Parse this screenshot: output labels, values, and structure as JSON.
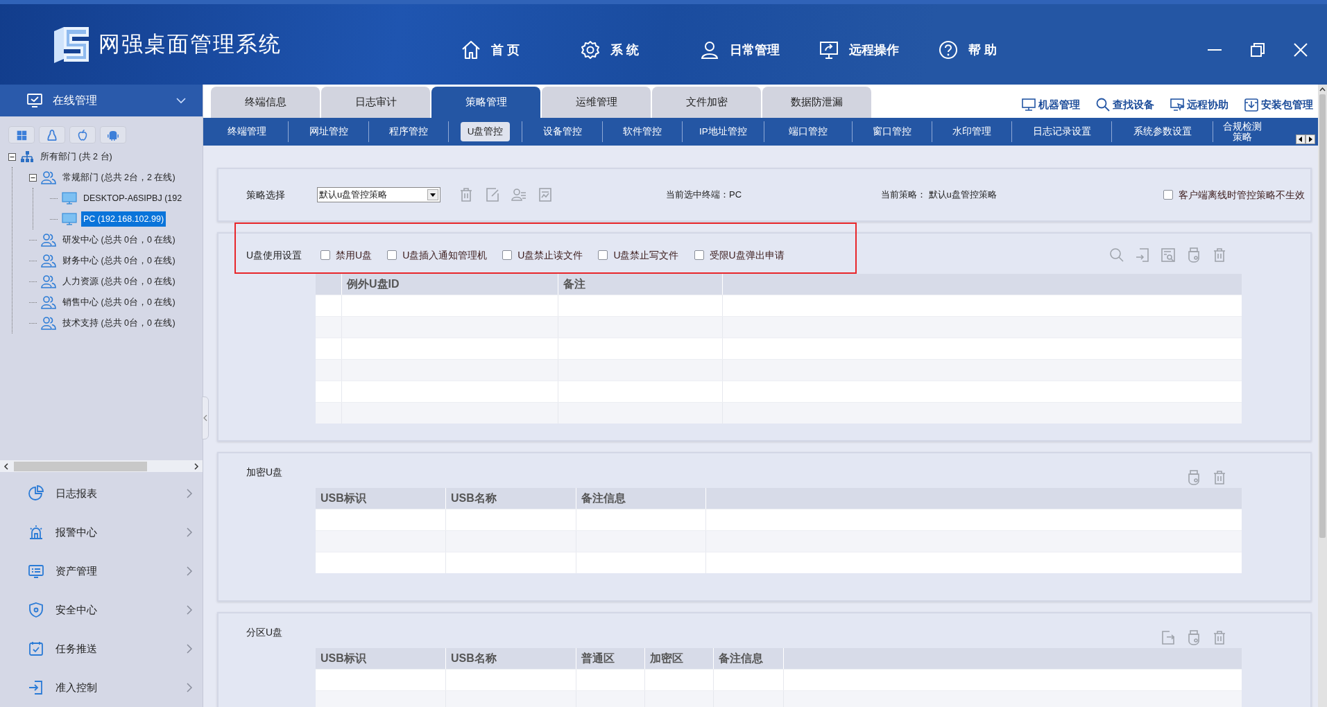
{
  "header": {
    "title": "网强桌面管理系统",
    "nav": [
      {
        "label": "首 页",
        "kind": "home"
      },
      {
        "label": "系 统",
        "kind": "settings"
      },
      {
        "label": "日常管理",
        "kind": "user"
      },
      {
        "label": "远程操作",
        "kind": "remote"
      },
      {
        "label": "帮 助",
        "kind": "help"
      }
    ]
  },
  "sidebar": {
    "section": {
      "label": "在线管理",
      "expanded": true
    },
    "tree": [
      {
        "label": "所有部门 (共 2 台)",
        "kind": "root",
        "expanded": true,
        "children": [
          {
            "label": "常规部门 (总共 2台，2 在线)",
            "kind": "group",
            "expanded": true,
            "children": [
              {
                "label": "DESKTOP-A6SIPBJ (192",
                "kind": "device",
                "selected": false
              },
              {
                "label": "PC (192.168.102.99)",
                "kind": "device",
                "selected": true
              }
            ]
          },
          {
            "label": "研发中心 (总共 0台，0 在线)",
            "kind": "group"
          },
          {
            "label": "财务中心 (总共 0台，0 在线)",
            "kind": "group"
          },
          {
            "label": "人力资源 (总共 0台，0 在线)",
            "kind": "group"
          },
          {
            "label": "销售中心 (总共 0台，0 在线)",
            "kind": "group"
          },
          {
            "label": "技术支持 (总共 0台，0 在线)",
            "kind": "group"
          }
        ]
      }
    ],
    "menu": [
      {
        "label": "日志报表",
        "kind": "report"
      },
      {
        "label": "报警中心",
        "kind": "alarm"
      },
      {
        "label": "资产管理",
        "kind": "asset"
      },
      {
        "label": "安全中心",
        "kind": "shield"
      },
      {
        "label": "任务推送",
        "kind": "task"
      },
      {
        "label": "准入控制",
        "kind": "access"
      }
    ]
  },
  "tabs": [
    {
      "label": "终端信息",
      "selected": false
    },
    {
      "label": "日志审计",
      "selected": false
    },
    {
      "label": "策略管理",
      "selected": true
    },
    {
      "label": "运维管理",
      "selected": false
    },
    {
      "label": "文件加密",
      "selected": false
    },
    {
      "label": "数据防泄漏",
      "selected": false
    }
  ],
  "tool_links": [
    {
      "label": "机器管理",
      "kind": "monitor"
    },
    {
      "label": "查找设备",
      "kind": "search"
    },
    {
      "label": "远程协助",
      "kind": "remote"
    },
    {
      "label": "安装包管理",
      "kind": "package"
    }
  ],
  "subtabs": [
    {
      "label": "终端管理",
      "selected": false
    },
    {
      "label": "网址管控",
      "selected": false
    },
    {
      "label": "程序管控",
      "selected": false
    },
    {
      "label": "U盘管控",
      "selected": true
    },
    {
      "label": "设备管控",
      "selected": false
    },
    {
      "label": "软件管控",
      "selected": false
    },
    {
      "label": "IP地址管控",
      "selected": false
    },
    {
      "label": "端口管控",
      "selected": false
    },
    {
      "label": "窗口管控",
      "selected": false
    },
    {
      "label": "水印管理",
      "selected": false
    },
    {
      "label": "日志记录设置",
      "selected": false
    },
    {
      "label": "系统参数设置",
      "selected": false
    },
    {
      "label": "合规检测策略",
      "selected": false
    }
  ],
  "policy": {
    "label": "策略选择",
    "select_value": "默认u盘管控策略",
    "current_terminal": "当前选中终端：PC",
    "current_policy": "当前策略： 默认u盘管控策略",
    "offline_option": {
      "label": "客户端离线时管控策略不生效",
      "checked": false
    }
  },
  "usb_settings": {
    "label": "U盘使用设置",
    "options": [
      {
        "label": "禁用U盘",
        "checked": false
      },
      {
        "label": "U盘插入通知管理机",
        "checked": false
      },
      {
        "label": "U盘禁止读文件",
        "checked": false
      },
      {
        "label": "U盘禁止写文件",
        "checked": false
      },
      {
        "label": "受限U盘弹出申请",
        "checked": false
      }
    ],
    "table": {
      "columns": [
        "例外U盘ID",
        "备注"
      ]
    }
  },
  "encrypted_usb": {
    "title": "加密U盘",
    "table": {
      "columns": [
        "USB标识",
        "USB名称",
        "备注信息"
      ]
    }
  },
  "partition_usb": {
    "title": "分区U盘",
    "table": {
      "columns": [
        "USB标识",
        "USB名称",
        "普通区",
        "加密区",
        "备注信息"
      ]
    }
  }
}
